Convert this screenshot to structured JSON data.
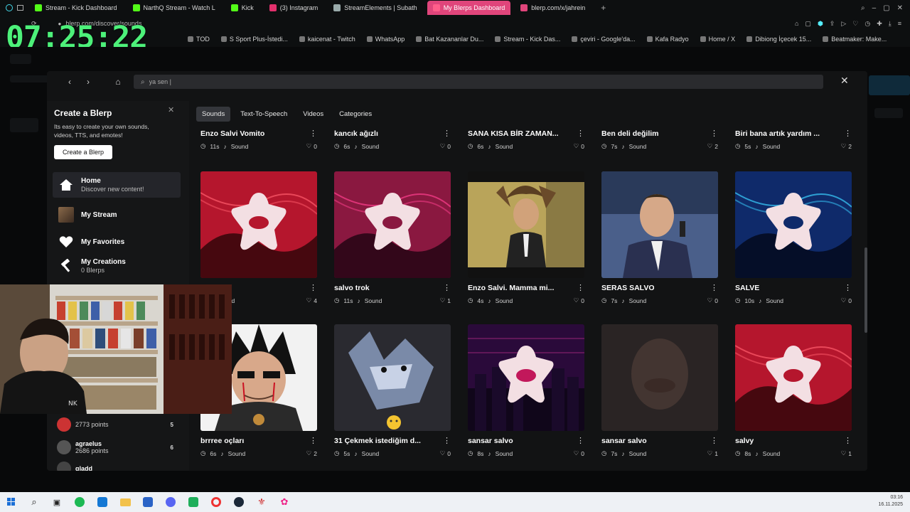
{
  "overlay": {
    "clock": "07:25:22"
  },
  "browser": {
    "tabs": [
      {
        "label": "Stream - Kick Dashboard",
        "color": "#53fc18",
        "active": false
      },
      {
        "label": "NarthQ Stream - Watch L",
        "color": "#53fc18",
        "active": false
      },
      {
        "label": "Kick",
        "color": "#53fc18",
        "active": false
      },
      {
        "label": "(3) Instagram",
        "color": "#e1306c",
        "active": false
      },
      {
        "label": "StreamElements | Subath",
        "color": "#9aa",
        "active": false
      },
      {
        "label": "My Blerps Dashboard",
        "color": "#ff5e8a",
        "active": true
      },
      {
        "label": "blerp.com/x/jahrein",
        "color": "#e0457b",
        "active": false
      }
    ],
    "url": "blerp.com/discover/sounds",
    "bookmarks": [
      "TOD",
      "S Sport Plus-İstedi...",
      "kaicenat - Twitch",
      "WhatsApp",
      "Bat Kazananlar Du...",
      "Stream - Kick Das...",
      "çeviri - Google'da...",
      "Kafa Radyo",
      "Home / X",
      "Dibiong İçecek 15...",
      "Beatmaker: Make..."
    ]
  },
  "search": {
    "value": "ya sen |"
  },
  "sidebar": {
    "create": {
      "title": "Create a Blerp",
      "description": "Its easy to create your own sounds, videos, TTS, and emotes!",
      "button": "Create a Blerp"
    },
    "nav": [
      {
        "label": "Home",
        "sub": "Discover new content!",
        "icon": "home-icon",
        "active": true
      },
      {
        "label": "My Stream",
        "sub": "",
        "icon": "stream-thumbnail",
        "active": false
      },
      {
        "label": "My Favorites",
        "sub": "",
        "icon": "heart-icon",
        "active": false
      },
      {
        "label": "My Creations",
        "sub": "0 Blerps",
        "icon": "hammer-icon",
        "active": false
      }
    ],
    "leaderboard": [
      {
        "name": "",
        "points": "2773 points",
        "rank": "5"
      },
      {
        "name": "agraelus",
        "points": "2686 points",
        "rank": "6"
      },
      {
        "name": "gladd",
        "points": "",
        "rank": ""
      }
    ]
  },
  "filters": [
    "Sounds",
    "Text-To-Speech",
    "Videos",
    "Categories"
  ],
  "cards_top_row": [
    {
      "title": "Enzo Salvi Vomito",
      "duration": "11s",
      "type": "Sound",
      "likes": "0"
    },
    {
      "title": "kancık ağızlı",
      "duration": "6s",
      "type": "Sound",
      "likes": "0"
    },
    {
      "title": "SANA KISA BİR ZAMAN...",
      "duration": "6s",
      "type": "Sound",
      "likes": "0"
    },
    {
      "title": "Ben deli değilim",
      "duration": "7s",
      "type": "Sound",
      "likes": "2"
    },
    {
      "title": "Biri bana artık yardım ...",
      "duration": "5s",
      "type": "Sound",
      "likes": "2"
    }
  ],
  "cards_middle_row": [
    {
      "title": "ve moto",
      "duration": "",
      "type": "Sound",
      "likes": "4",
      "thumb": "blerp-red"
    },
    {
      "title": "salvo trok",
      "duration": "11s",
      "type": "Sound",
      "likes": "1",
      "thumb": "blerp-magenta"
    },
    {
      "title": "Enzo Salvi. Mamma mi...",
      "duration": "4s",
      "type": "Sound",
      "likes": "0",
      "thumb": "photo-man-hair"
    },
    {
      "title": "SERAS SALVO",
      "duration": "7s",
      "type": "Sound",
      "likes": "0",
      "thumb": "photo-man-suit"
    },
    {
      "title": "SALVE",
      "duration": "10s",
      "type": "Sound",
      "likes": "0",
      "thumb": "blerp-blue"
    }
  ],
  "cards_bottom_row": [
    {
      "title": "brrree oçları",
      "duration": "6s",
      "type": "Sound",
      "likes": "2",
      "thumb": "avatar-warrior"
    },
    {
      "title": "31 Çekmek istediğim d...",
      "duration": "5s",
      "type": "Sound",
      "likes": "0",
      "thumb": "wolf-meme"
    },
    {
      "title": "sansar salvo",
      "duration": "8s",
      "type": "Sound",
      "likes": "0",
      "thumb": "blerp-city"
    },
    {
      "title": "sansar salvo",
      "duration": "7s",
      "type": "Sound",
      "likes": "1",
      "thumb": "blurry-face"
    },
    {
      "title": "salvy",
      "duration": "8s",
      "type": "Sound",
      "likes": "1",
      "thumb": "blerp-red"
    }
  ],
  "system": {
    "time": "03:16",
    "date": "16.11.2025"
  }
}
